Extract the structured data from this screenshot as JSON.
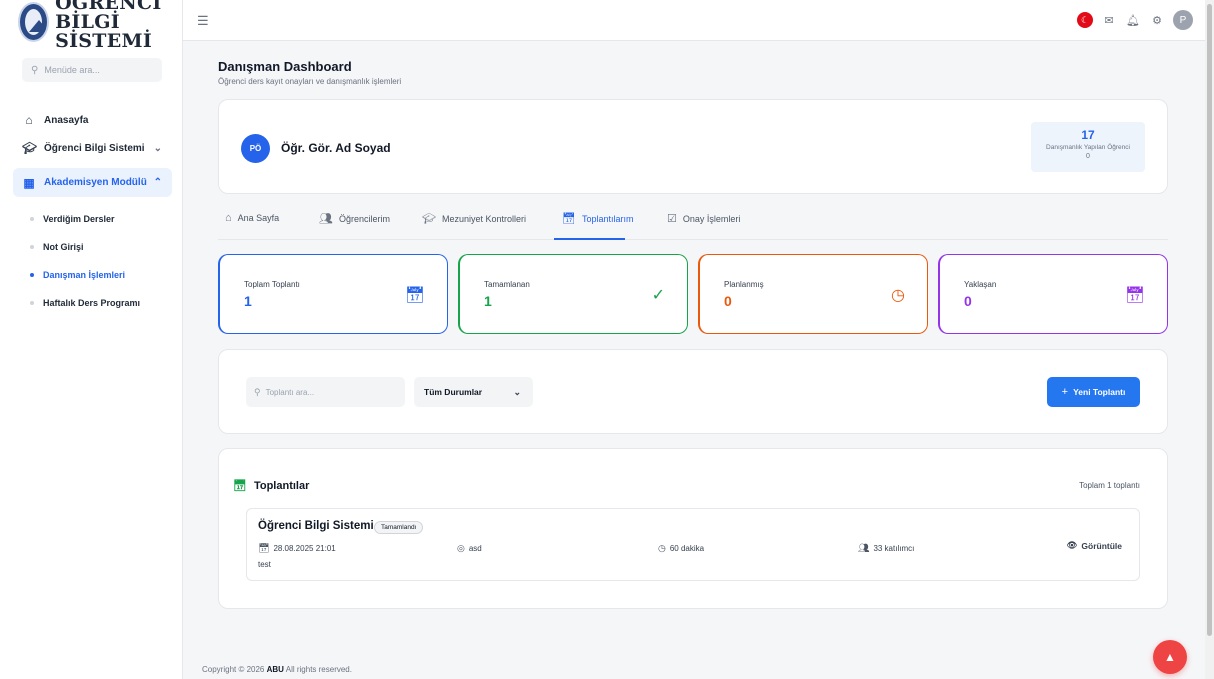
{
  "brand": {
    "line1": "ÖĞRENCİ",
    "line2": "BİLGİ SİSTEMİ"
  },
  "sidebar": {
    "search_placeholder": "Menüde ara...",
    "items": [
      {
        "label": "Anasayfa",
        "icon": "home-icon"
      },
      {
        "label": "Öğrenci Bilgi Sistemi",
        "icon": "graduation-icon"
      },
      {
        "label": "Akademisyen Modülü",
        "icon": "board-icon"
      }
    ],
    "subitems": [
      {
        "label": "Verdiğim Dersler"
      },
      {
        "label": "Not Girişi"
      },
      {
        "label": "Danışman İşlemleri"
      },
      {
        "label": "Haftalık Ders Programı"
      }
    ]
  },
  "topbar": {
    "avatar_letter": "P"
  },
  "header": {
    "title": "Danışman Dashboard",
    "subtitle": "Öğrenci ders kayıt onayları ve danışmanlık işlemleri"
  },
  "profile": {
    "initials": "PÖ",
    "name": "Öğr. Gör. Ad Soyad",
    "stat_value": "17",
    "stat_label": "Danışmanlık Yapılan Öğrenci",
    "stat_sub": "0"
  },
  "tabs": [
    {
      "label": "Ana Sayfa"
    },
    {
      "label": "Öğrencilerim"
    },
    {
      "label": "Mezuniyet Kontrolleri"
    },
    {
      "label": "Toplantılarım"
    },
    {
      "label": "Onay İşlemleri"
    }
  ],
  "stats": [
    {
      "label": "Toplam Toplantı",
      "value": "1",
      "color": "#2563eb"
    },
    {
      "label": "Tamamlanan",
      "value": "1",
      "color": "#16a34a"
    },
    {
      "label": "Planlanmış",
      "value": "0",
      "color": "#ea580c"
    },
    {
      "label": "Yaklaşan",
      "value": "0",
      "color": "#9333ea"
    }
  ],
  "filter": {
    "search_placeholder": "Toplantı ara...",
    "status_selected": "Tüm Durumlar",
    "new_button": "Yeni Toplantı"
  },
  "meetings": {
    "title": "Toplantılar",
    "count_text": "Toplam 1 toplantı",
    "items": [
      {
        "title": "Öğrenci Bilgi Sistemi",
        "status": "Tamamlandı",
        "datetime": "28.08.2025 21:01",
        "location": "asd",
        "duration": "60 dakika",
        "participants": "33 katılımcı",
        "view_label": "Görüntüle",
        "description": "test"
      }
    ]
  },
  "footer": {
    "prefix": "Copyright © 2026",
    "brand": "ABU",
    "suffix": "All rights reserved."
  }
}
